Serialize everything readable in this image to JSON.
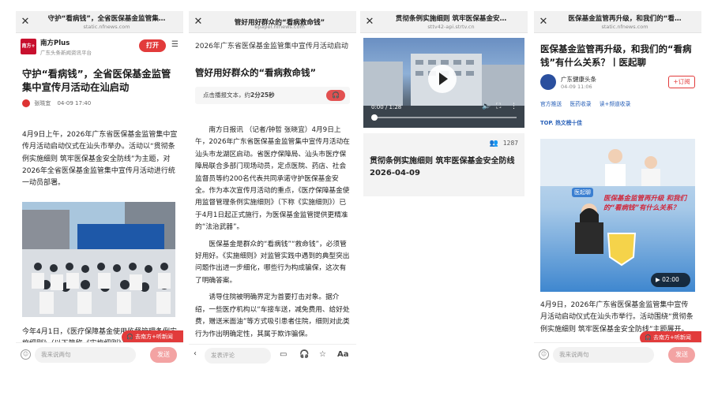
{
  "screen1": {
    "title": "守护“看病钱”，全省医保基金监管集…",
    "url": "static.nfnews.com",
    "brand_logo": "南方+",
    "brand_name": "南方Plus",
    "brand_sub": "广东头条新闻资讯平台",
    "open_label": "打开",
    "headline": "守护“看病钱”，全省医保基金监管集中宣传月活动在汕启动",
    "author": "张晓宜",
    "date": "04-09 17:40",
    "para1": "4月9日上午，2026年广东省医保基金监管集中宣传月活动启动仪式在汕头市举办。活动以“贯彻条例实施细则 筑牢医保基金安全防线”为主题，对2026年全省医保基金监管集中宣传月活动进行统一动员部署。",
    "photo_text": "贯彻条例实施细则 筑牢医保基金安全防线",
    "para2": "今年4月1日，《医疗保障基金使用监督管理条例实施细则》（以下简称《实施细则》）",
    "float_label": "去南方+听新闻",
    "comment_placeholder": "我来说两句",
    "send_label": "发送"
  },
  "screen2": {
    "title": "管好用好群众的“看病救命钱”",
    "url": "epaper.nfnews.com",
    "headline_small": "2026年广东省医保基金监管集中宣传月活动启动",
    "headline_big": "管好用好群众的“看病救命钱”",
    "audio_prefix": "点击播报文本，约",
    "audio_duration": "2分25秒",
    "body_p1": "南方日报讯 （记者/钟哲 张晓宜）4月9日上午，2026年广东省医保基金监管集中宣传月活动在汕头市龙湖区启动。省医疗保障局、汕头市医疗保障局联合多部门现场动员，定点医院、药店、社会监督员等约200名代表共同承诺守护医保基金安全。作为本次宣传月活动的重点，《医疗保障基金使用监督管理条例实施细则》（下称《实施细则》）已于4月1日起正式施行，为医保基金监管提供更精准的“法治武器”。",
    "body_p2": "医保基金是群众的“看病钱”“救命钱”，必须管好用好。《实施细则》对监管实践中遇到的典型突出问题作出进一步细化，哪些行为构成骗保，这次有了明确答案。",
    "body_p3": "诱导住院被明确界定为首要打击对象。据介绍，一些医疗机构以“车接车送，减免费用、给好处费，赠送米面油”等方式吸引患者住院，细则对此类行为作出明确定性，其属于欺诈骗保。",
    "comment_placeholder": "发表评论",
    "font_label": "Aa"
  },
  "screen3": {
    "title": "贯彻条例实施细则 筑牢医保基金安…",
    "url": "sttv42-api.strtv.cn",
    "video_time": "0:00 / 1:28",
    "viewers": "1287",
    "video_title": "贯彻条例实施细则 筑牢医保基金安全防线 2026-04-09"
  },
  "screen4": {
    "title": "医保基金监管再升级，和我们的“看…",
    "url": "static.nfnews.com",
    "headline": "医保基金监管再升级，和我们的“看病钱”有什么关系？丨医起聊",
    "author": "广东健康头条",
    "date": "04-09 11:06",
    "follow_label": "+订阅",
    "tags": [
      "官方推送",
      "医药收录",
      "读+频道收录"
    ],
    "topic": "TOP. 热文榜十佳",
    "poster_text": "医保基金监管再升级 和我们的“看病钱”有什么关系？",
    "poster_brand": "医起聊",
    "video_badge": "02:00",
    "para": "4月9日，2026年广东省医保基金监管集中宣传月活动启动仪式在汕头市举行。活动围绕“贯彻条例实施细则 筑牢医保基金安全防线”主题展开。",
    "float_label": "去南方+听新闻",
    "comment_placeholder": "我来说两句",
    "send_label": "发送"
  },
  "colors": {
    "accent": "#e23b3b",
    "link": "#2860b8"
  },
  "icons": [
    "close-icon",
    "menu-icon",
    "headphones-icon",
    "emoji-icon",
    "back-icon",
    "comment-icon",
    "bookmark-icon",
    "star-icon",
    "play-icon",
    "person-icon",
    "fullscreen-icon"
  ]
}
